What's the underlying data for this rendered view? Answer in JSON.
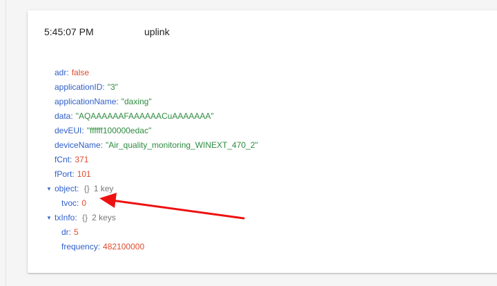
{
  "header": {
    "time": "5:45:07 PM",
    "type": "uplink"
  },
  "fields": [
    {
      "key": "adr",
      "value": "false",
      "kind": "bool"
    },
    {
      "key": "applicationID",
      "value": "\"3\"",
      "kind": "string"
    },
    {
      "key": "applicationName",
      "value": "\"daxing\"",
      "kind": "string"
    },
    {
      "key": "data",
      "value": "\"AQAAAAAAFAAAAAACuAAAAAAA\"",
      "kind": "string"
    },
    {
      "key": "devEUI",
      "value": "\"ffffff100000edac\"",
      "kind": "string"
    },
    {
      "key": "deviceName",
      "value": "\"Air_quality_monitoring_WINEXT_470_2\"",
      "kind": "string"
    },
    {
      "key": "fCnt",
      "value": "371",
      "kind": "number"
    },
    {
      "key": "fPort",
      "value": "101",
      "kind": "number"
    }
  ],
  "object": {
    "key": "object",
    "brace": "{}",
    "count": "1 key",
    "children": [
      {
        "key": "tvoc",
        "value": "0"
      }
    ]
  },
  "txInfo": {
    "key": "txInfo",
    "brace": "{}",
    "count": "2 keys",
    "children": [
      {
        "key": "dr",
        "value": "5"
      },
      {
        "key": "frequency",
        "value": "482100000"
      }
    ]
  },
  "colors": {
    "key": "#2d5ec8",
    "string": "#2e8b40",
    "number": "#e04a2e",
    "annotation_arrow": "#ee1111"
  },
  "icons": {
    "expand": "triangle-down-icon",
    "annotation": "red-arrow-annotation"
  }
}
